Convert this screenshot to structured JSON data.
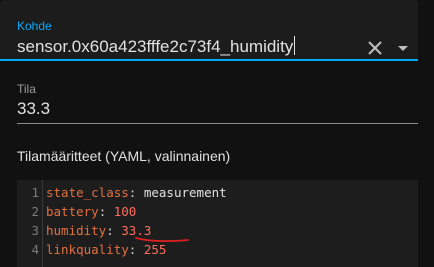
{
  "entity": {
    "label": "Kohde",
    "value": "sensor.0x60a423fffe2c73f4_humidity",
    "clear_icon": "close-icon",
    "dropdown_icon": "chevron-down-icon"
  },
  "state": {
    "label": "Tila",
    "value": "33.3"
  },
  "attributes": {
    "heading": "Tilamääritteet (YAML, valinnainen)",
    "lines": [
      {
        "num": "1",
        "key": "state_class",
        "sep": ": ",
        "value": "measurement",
        "kind": "string"
      },
      {
        "num": "2",
        "key": "battery",
        "sep": ": ",
        "value": "100",
        "kind": "number"
      },
      {
        "num": "3",
        "key": "humidity",
        "sep": ": ",
        "value": "33.3",
        "kind": "number"
      },
      {
        "num": "4",
        "key": "linkquality",
        "sep": ": ",
        "value": "255",
        "kind": "number"
      }
    ]
  },
  "colors": {
    "accent": "#03a9f4",
    "background": "#111111",
    "field_background": "#1c1c1c",
    "yaml_key": "#e3703f",
    "yaml_number": "#ff6c5c",
    "annotation_underline": "#e02020"
  }
}
